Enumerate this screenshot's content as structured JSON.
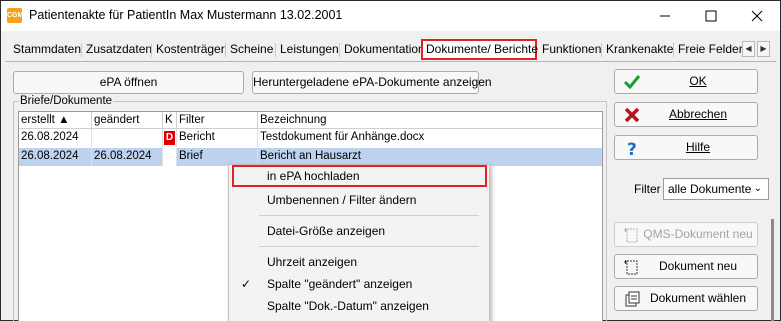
{
  "window": {
    "title": "Patientenakte für PatientIn Max Mustermann 13.02.2001",
    "app_icon_text": "CGM"
  },
  "tabs": [
    {
      "label": "Stammdaten"
    },
    {
      "label": "Zusatzdaten"
    },
    {
      "label": "Kostenträger"
    },
    {
      "label": "Scheine"
    },
    {
      "label": "Leistungen"
    },
    {
      "label": "Dokumentation"
    },
    {
      "label": "Dokumente/ Berichte",
      "active": true
    },
    {
      "label": "Funktionen"
    },
    {
      "label": "Krankenakte"
    },
    {
      "label": "Freie Felder"
    }
  ],
  "toolbar": {
    "epa_open": "ePA öffnen",
    "epa_downloaded": "Heruntergeladene ePA-Dokumente anzeigen"
  },
  "group_label": "Briefe/Dokumente",
  "table": {
    "headers": [
      "erstellt ▲",
      "geändert",
      "K",
      "Filter",
      "Bezeichnung"
    ],
    "rows": [
      {
        "erstellt": "26.08.2024",
        "geaendert": "",
        "k": "D",
        "filter": "Bericht",
        "bezeichnung": "Testdokument für Anhänge.docx",
        "selected": false
      },
      {
        "erstellt": "26.08.2024",
        "geaendert": "26.08.2024",
        "k": "",
        "filter": "Brief",
        "bezeichnung": "Bericht an Hausarzt",
        "selected": true
      }
    ]
  },
  "context_menu": {
    "upload": "in ePA hochladen",
    "rename": "Umbenennen / Filter ändern",
    "filesize": "Datei-Größe anzeigen",
    "show_time": "Uhrzeit anzeigen",
    "col_changed": "Spalte \"geändert\" anzeigen",
    "col_changed_checked": true,
    "col_docdate": "Spalte \"Dok.-Datum\" anzeigen"
  },
  "right_panel": {
    "ok": "OK",
    "cancel": "Abbrechen",
    "help": "Hilfe",
    "filter_label": "Filter",
    "filter_value": "alle Dokumente",
    "qms_new": "QMS-Dokument neu",
    "doc_new": "Dokument neu",
    "doc_select": "Dokument wählen"
  },
  "colors": {
    "highlight_border": "#e32227",
    "selection": "#bcd2ef",
    "badge_red": "#e10000"
  }
}
